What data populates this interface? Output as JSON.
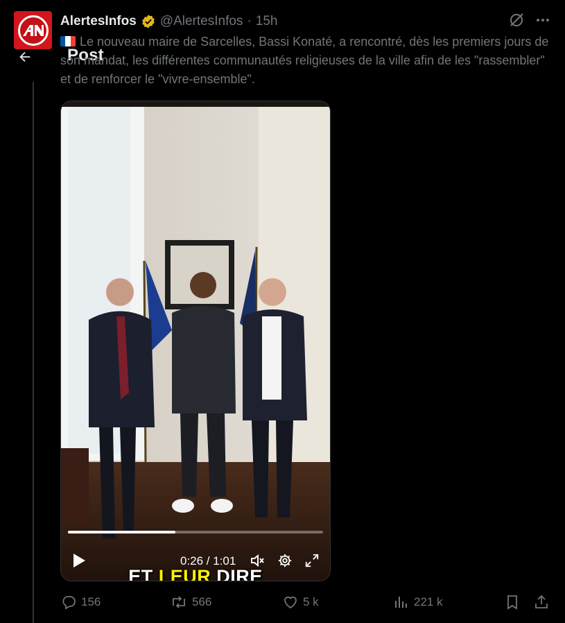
{
  "nav": {
    "title": "Post"
  },
  "tweet": {
    "display_name": "AlertesInfos",
    "handle": "@AlertesInfos",
    "separator": "·",
    "time": "15h",
    "text": "Le nouveau maire de Sarcelles, Bassi Konaté, a rencontré, dès les premiers jours de son mandat, les différentes communautés religieuses de la ville afin de les \"rassembler\" et de renforcer le \"vivre-ensemble\".",
    "verified_color": "#e2b719",
    "flag_colors": [
      "#0055a4",
      "#ffffff",
      "#ef4135"
    ]
  },
  "video": {
    "caption_before": "ET ",
    "caption_highlight": "LEUR",
    "caption_after": " DIRE",
    "highlight_color": "#fff200",
    "time_display": "0:26 / 1:01",
    "progress": 0.42
  },
  "actions": {
    "replies": "156",
    "reposts": "566",
    "likes": "5 k",
    "views": "221 k"
  },
  "icons": {
    "back": "arrow-left-icon",
    "grok": "grok-icon",
    "more": "more-icon",
    "play": "play-icon",
    "mute": "mute-icon",
    "settings": "gear-icon",
    "fullscreen": "fullscreen-icon",
    "reply": "reply-icon",
    "repost": "repost-icon",
    "like": "heart-icon",
    "views": "views-icon",
    "bookmark": "bookmark-icon",
    "share": "share-icon"
  }
}
